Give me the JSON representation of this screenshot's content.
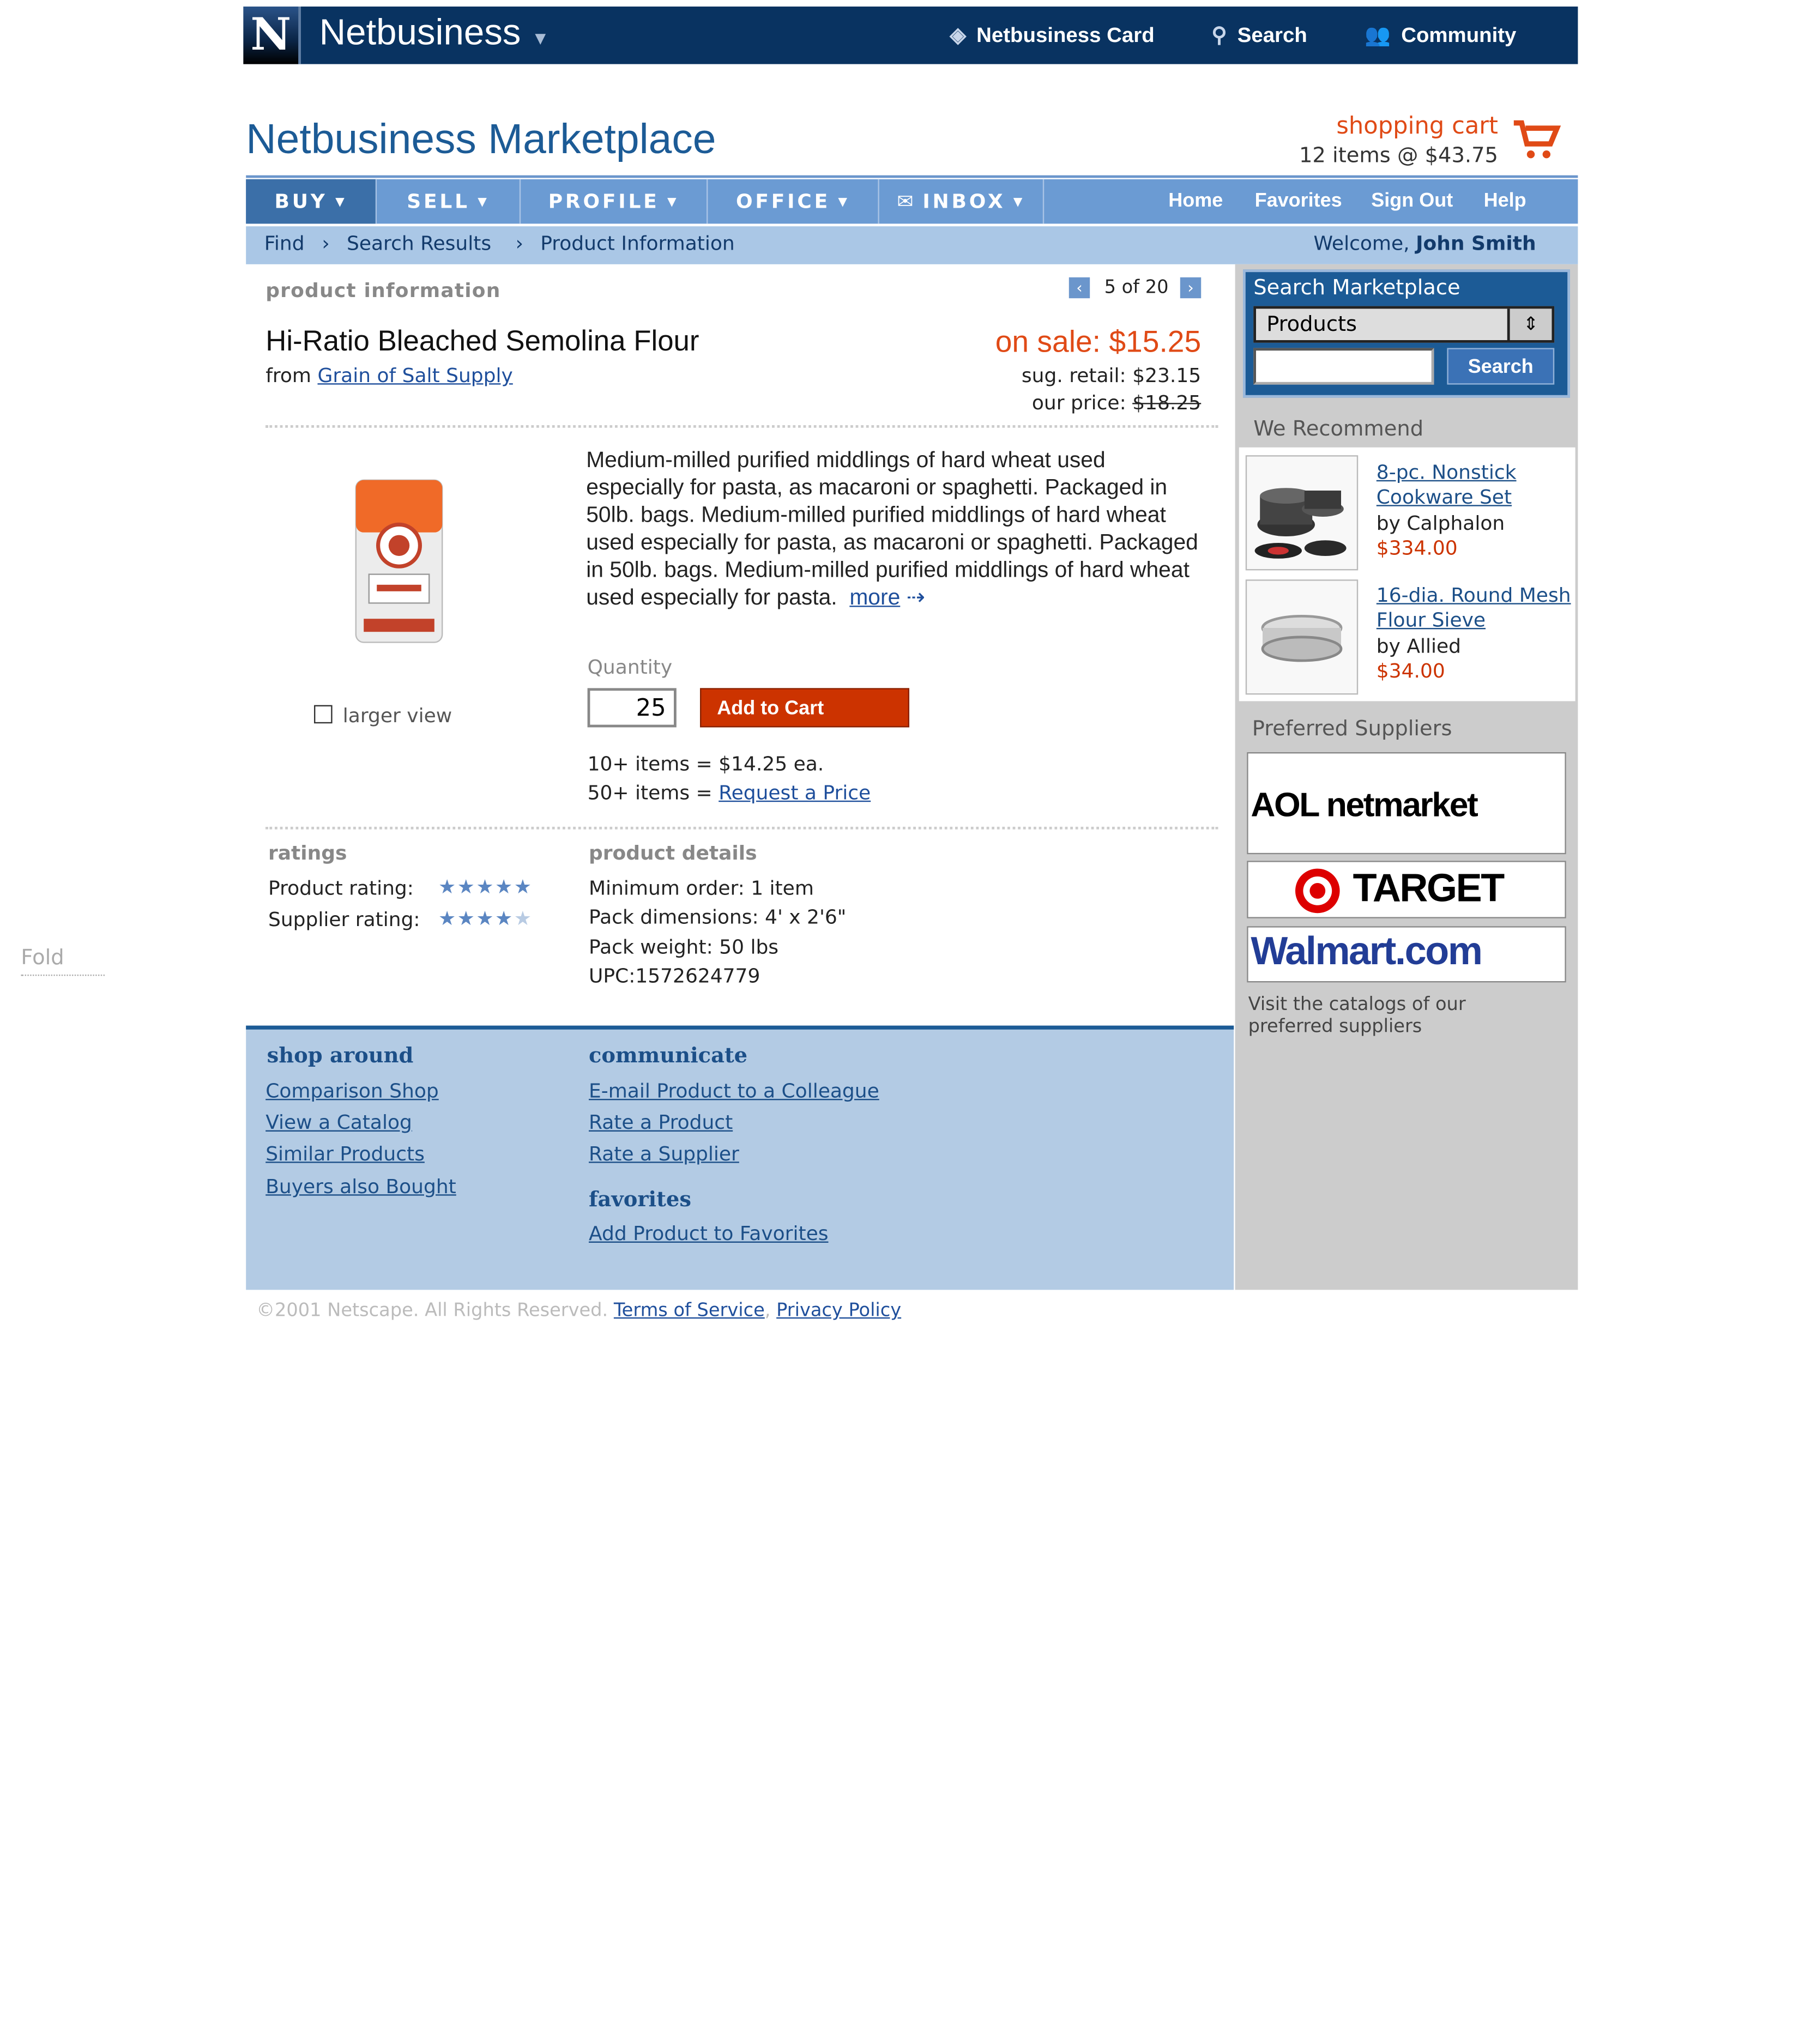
{
  "topbar": {
    "logo_letter": "N",
    "brand": "Netbusiness",
    "nav": [
      {
        "label": "Netbusiness Card",
        "icon": "card-icon"
      },
      {
        "label": "Search",
        "icon": "search-icon"
      },
      {
        "label": "Community",
        "icon": "community-icon"
      }
    ]
  },
  "header": {
    "title": "Netbusiness Marketplace",
    "cart_title": "shopping cart",
    "cart_summary": "12 items @ $43.75"
  },
  "menu": {
    "items": [
      "BUY",
      "SELL",
      "PROFILE",
      "OFFICE",
      "INBOX"
    ],
    "right_links": [
      "Home",
      "Favorites",
      "Sign Out",
      "Help"
    ]
  },
  "breadcrumb": {
    "items": [
      "Find",
      "Search Results",
      "Product Information"
    ],
    "welcome_prefix": "Welcome,",
    "user": "John Smith"
  },
  "product": {
    "section_label": "product information",
    "pager": "5 of 20",
    "name": "Hi-Ratio Bleached Semolina Flour",
    "from_prefix": "from",
    "supplier": "Grain of Salt Supply",
    "sale": "on sale: $15.25",
    "sug_retail_label": "sug. retail:",
    "sug_retail": "$23.15",
    "our_price_label": "our price:",
    "our_price": "$18.25",
    "larger_view": "larger view",
    "description": "Medium-milled purified middlings of hard wheat used especially for pasta, as macaroni or spaghetti. Packaged in 50lb. bags. Medium-milled purified middlings of hard wheat used especially for pasta, as macaroni or spaghetti. Packaged in 50lb. bags. Medium-milled purified middlings of hard wheat used especially for pasta.",
    "more": "more",
    "quantity_label": "Quantity",
    "quantity": "25",
    "add_to_cart": "Add to Cart",
    "tier1": "10+ items = $14.25 ea.",
    "tier2_prefix": "50+ items =",
    "tier2_link": "Request a Price"
  },
  "ratings": {
    "heading": "ratings",
    "product_label": "Product rating:",
    "product_stars": 5,
    "supplier_label": "Supplier rating:",
    "supplier_stars": 4
  },
  "details": {
    "heading": "product details",
    "lines": [
      "Minimum order: 1 item",
      "Pack dimensions: 4' x 2'6\"",
      "Pack weight: 50 lbs",
      "UPC:1572624779"
    ]
  },
  "footer_panel": {
    "shop_heading": "shop around",
    "shop_links": [
      "Comparison Shop",
      "View a Catalog",
      "Similar Products",
      "Buyers also Bought"
    ],
    "comm_heading": "communicate",
    "comm_links": [
      "E-mail Product to a Colleague",
      "Rate a Product",
      "Rate a Supplier"
    ],
    "fav_heading": "favorites",
    "fav_links": [
      "Add Product to Favorites"
    ]
  },
  "sidebar": {
    "search_title": "Search Marketplace",
    "select_value": "Products",
    "search_button": "Search",
    "recommend_heading": "We Recommend",
    "recommendations": [
      {
        "title_line1": "8-pc. Nonstick",
        "title_line2": "Cookware Set",
        "by": "by Calphalon",
        "price": "$334.00"
      },
      {
        "title_line1": "16-dia. Round Mesh",
        "title_line2": "Flour Sieve",
        "by": "by Allied",
        "price": "$34.00"
      }
    ],
    "suppliers_heading": "Preferred Suppliers",
    "suppliers": [
      "AOL netmarket",
      "TARGET",
      "Walmart.com"
    ],
    "visit_text": "Visit the catalogs of our preferred suppliers"
  },
  "copyright": {
    "text": "©2001 Netscape. All Rights Reserved.",
    "terms": "Terms of Service",
    "privacy": "Privacy Policy"
  },
  "fold_label": "Fold",
  "colors": {
    "topbar": "#093361",
    "menu": "#6b9bd3",
    "accent": "#e04a16",
    "button": "#cc3300",
    "panel": "#b3cbe4"
  }
}
